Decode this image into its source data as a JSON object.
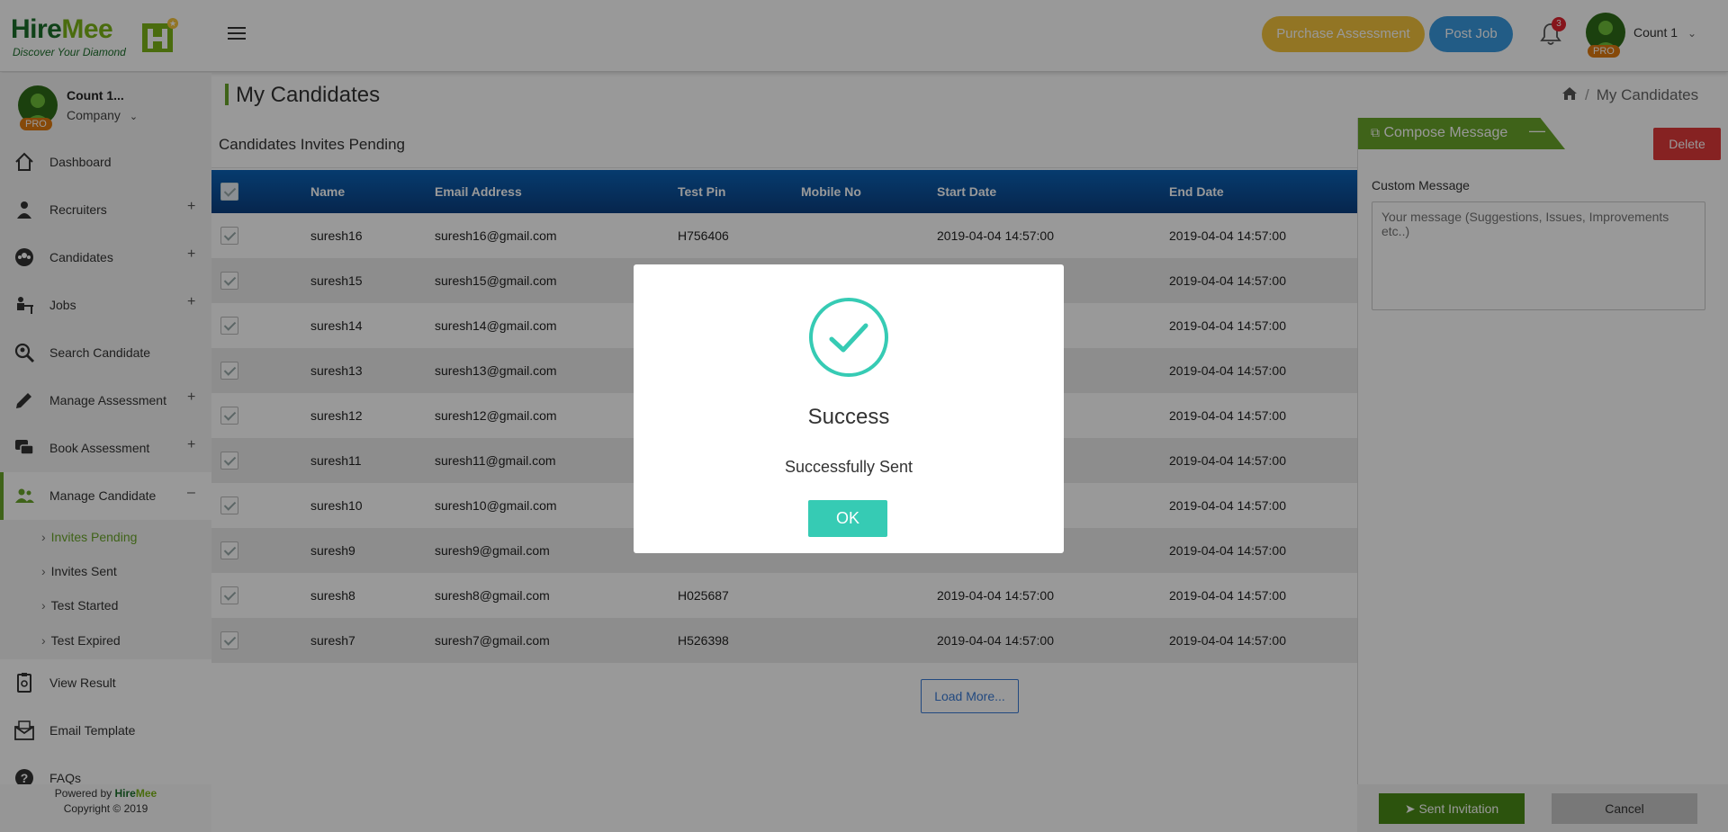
{
  "header": {
    "logo_text_hire": "Hire",
    "logo_text_mee": "Mee",
    "logo_tagline": "Discover Your Diamond",
    "purchase_label": "Purchase Assessment",
    "post_job_label": "Post Job",
    "notification_count": "3",
    "user_name": "Count 1",
    "pro_label": "PRO"
  },
  "sidebar": {
    "profile_name": "Count 1...",
    "profile_role": "Company",
    "pro_label": "PRO",
    "items": [
      {
        "label": "Dashboard",
        "icon": "home-icon",
        "expand": ""
      },
      {
        "label": "Recruiters",
        "icon": "user-icon",
        "expand": "+"
      },
      {
        "label": "Candidates",
        "icon": "users-circle-icon",
        "expand": "+"
      },
      {
        "label": "Jobs",
        "icon": "desk-icon",
        "expand": "+"
      },
      {
        "label": "Search Candidate",
        "icon": "search-user-icon",
        "expand": ""
      },
      {
        "label": "Manage Assessment",
        "icon": "pencil-icon",
        "expand": "+"
      },
      {
        "label": "Book Assessment",
        "icon": "chat-icon",
        "expand": "+"
      },
      {
        "label": "Manage Candidate",
        "icon": "group-icon",
        "expand": "–"
      },
      {
        "label": "View Result",
        "icon": "clipboard-icon",
        "expand": ""
      },
      {
        "label": "Email Template",
        "icon": "email-icon",
        "expand": ""
      },
      {
        "label": "FAQs",
        "icon": "help-icon",
        "expand": ""
      }
    ],
    "sub_items": [
      "Invites Pending",
      "Invites Sent",
      "Test Started",
      "Test Expired"
    ],
    "footer_powered": "Powered by",
    "footer_copyright": "Copyright © 2019"
  },
  "main": {
    "page_title": "My Candidates",
    "breadcrumb_current": "My Candidates",
    "panel_title": "Candidates Invites Pending",
    "columns": [
      "Name",
      "Email Address",
      "Test Pin",
      "Mobile No",
      "Start Date",
      "End Date"
    ],
    "rows": [
      [
        "suresh16",
        "suresh16@gmail.com",
        "H756406",
        "",
        "2019-04-04 14:57:00",
        "2019-04-04 14:57:00"
      ],
      [
        "suresh15",
        "suresh15@gmail.com",
        "",
        "",
        "",
        "2019-04-04 14:57:00"
      ],
      [
        "suresh14",
        "suresh14@gmail.com",
        "",
        "",
        "",
        "2019-04-04 14:57:00"
      ],
      [
        "suresh13",
        "suresh13@gmail.com",
        "",
        "",
        "",
        "2019-04-04 14:57:00"
      ],
      [
        "suresh12",
        "suresh12@gmail.com",
        "",
        "",
        "",
        "2019-04-04 14:57:00"
      ],
      [
        "suresh11",
        "suresh11@gmail.com",
        "",
        "",
        "",
        "2019-04-04 14:57:00"
      ],
      [
        "suresh10",
        "suresh10@gmail.com",
        "",
        "",
        "",
        "2019-04-04 14:57:00"
      ],
      [
        "suresh9",
        "suresh9@gmail.com",
        "",
        "",
        "",
        "2019-04-04 14:57:00"
      ],
      [
        "suresh8",
        "suresh8@gmail.com",
        "H025687",
        "",
        "2019-04-04 14:57:00",
        "2019-04-04 14:57:00"
      ],
      [
        "suresh7",
        "suresh7@gmail.com",
        "H526398",
        "",
        "2019-04-04 14:57:00",
        "2019-04-04 14:57:00"
      ]
    ],
    "load_more_label": "Load More..."
  },
  "compose": {
    "tab_label": "Compose Message",
    "delete_label": "Delete",
    "custom_message_label": "Custom Message",
    "message_placeholder": "Your message (Suggestions, Issues, Improvements etc..)",
    "sent_label": "Sent Invitation",
    "cancel_label": "Cancel"
  },
  "modal": {
    "title": "Success",
    "text": "Successfully Sent",
    "ok_label": "OK"
  },
  "colors": {
    "brand_green": "#6aa52a",
    "table_header_blue": "#0a63b8",
    "purchase_yellow": "#f3c43c",
    "post_job_blue": "#3a9ae0",
    "success_teal": "#36cbb4",
    "delete_red": "#e03a3a"
  }
}
